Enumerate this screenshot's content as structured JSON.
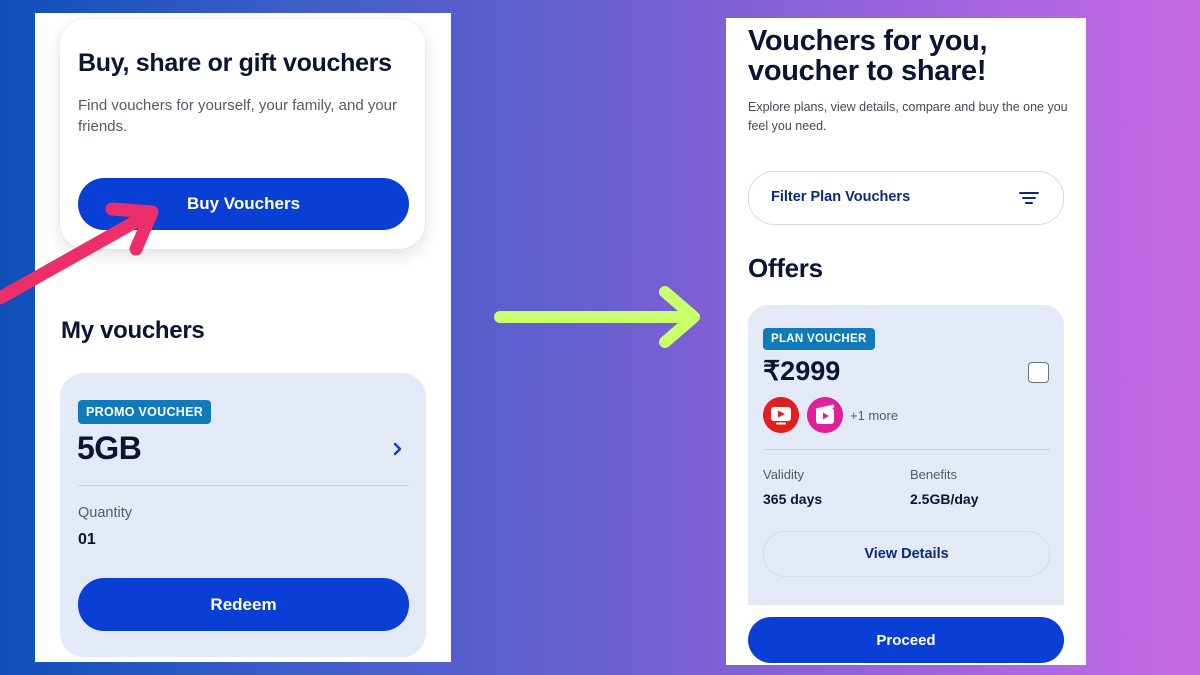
{
  "left": {
    "buy_card": {
      "title": "Buy, share or gift vouchers",
      "subtitle": "Find vouchers for yourself, your family, and your friends.",
      "button_label": "Buy Vouchers"
    },
    "my_vouchers": {
      "title": "My vouchers",
      "voucher": {
        "tag": "PROMO VOUCHER",
        "amount": "5GB",
        "quantity_label": "Quantity",
        "quantity_value": "01",
        "button_label": "Redeem"
      }
    }
  },
  "right": {
    "title": "Vouchers for you, voucher to share!",
    "subtitle": "Explore plans, view details, compare and buy the one you feel you need.",
    "filter_label": "Filter Plan Vouchers",
    "offers_title": "Offers",
    "offer": {
      "tag": "PLAN VOUCHER",
      "price": "₹2999",
      "more_apps": "+1 more",
      "validity_label": "Validity",
      "validity_value": "365 days",
      "benefits_label": "Benefits",
      "benefits_value": "2.5GB/day",
      "details_label": "View Details"
    },
    "proceed_label": "Proceed"
  },
  "colors": {
    "primary_blue": "#0a3fd6",
    "tag_teal": "#0f7bbb",
    "card_bg": "#e3e9f6",
    "pink_arrow": "#ec2f6b",
    "green_arrow": "#c8ff6a"
  },
  "icons": [
    "chevron-right-icon",
    "filter-icon",
    "youtube-icon",
    "jiocinema-icon",
    "checkbox-icon",
    "pink-pointer-arrow",
    "green-transition-arrow"
  ]
}
